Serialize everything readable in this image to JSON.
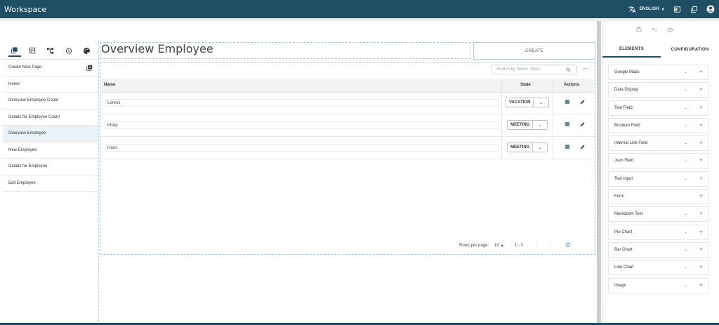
{
  "topbar": {
    "title": "Workspace",
    "language": "ENGLISH"
  },
  "left_tabs": [
    "pages-icon",
    "layout-icon",
    "tree-icon",
    "history-icon",
    "palette-icon"
  ],
  "pages": [
    {
      "label": "Create New Page"
    },
    {
      "label": "Home"
    },
    {
      "label": "Overview Employee Count"
    },
    {
      "label": "Details for Employee Count"
    },
    {
      "label": "Overview Employee"
    },
    {
      "label": "New Employee"
    },
    {
      "label": "Details for Employee"
    },
    {
      "label": "Edit Employee"
    }
  ],
  "main": {
    "title": "Overview Employee",
    "create_label": "CREATE",
    "search_placeholder": "Search by Name, State",
    "columns": {
      "name": "Name",
      "state": "State",
      "actions": "Actions"
    },
    "rows": [
      {
        "name": "Lorenz",
        "state": "VACATION"
      },
      {
        "name": "Philip",
        "state": "MEETING"
      },
      {
        "name": "Hans",
        "state": "MEETING"
      }
    ],
    "footer": {
      "rows_per_page_label": "Rows per page:",
      "rows_per_page": "10",
      "range": "1 - 3"
    }
  },
  "right_panel": {
    "tabs": [
      "ELEMENTS",
      "CONFIGURATION"
    ],
    "elements": [
      {
        "label": "Google Maps",
        "expandable": true
      },
      {
        "label": "Data Display",
        "expandable": true
      },
      {
        "label": "Text Field",
        "expandable": true
      },
      {
        "label": "Boolean Field",
        "expandable": true
      },
      {
        "label": "Internal Link Field",
        "expandable": true
      },
      {
        "label": "Json Field",
        "expandable": true
      },
      {
        "label": "Text Input",
        "expandable": true
      },
      {
        "label": "Form",
        "expandable": false
      },
      {
        "label": "Markdown Text",
        "expandable": true
      },
      {
        "label": "Pie Chart",
        "expandable": true
      },
      {
        "label": "Bar Chart",
        "expandable": true
      },
      {
        "label": "Line Chart",
        "expandable": true
      },
      {
        "label": "Image",
        "expandable": true
      }
    ]
  },
  "colors": {
    "accent": "#1e4f64",
    "selected_row": "#e9f3f8"
  }
}
